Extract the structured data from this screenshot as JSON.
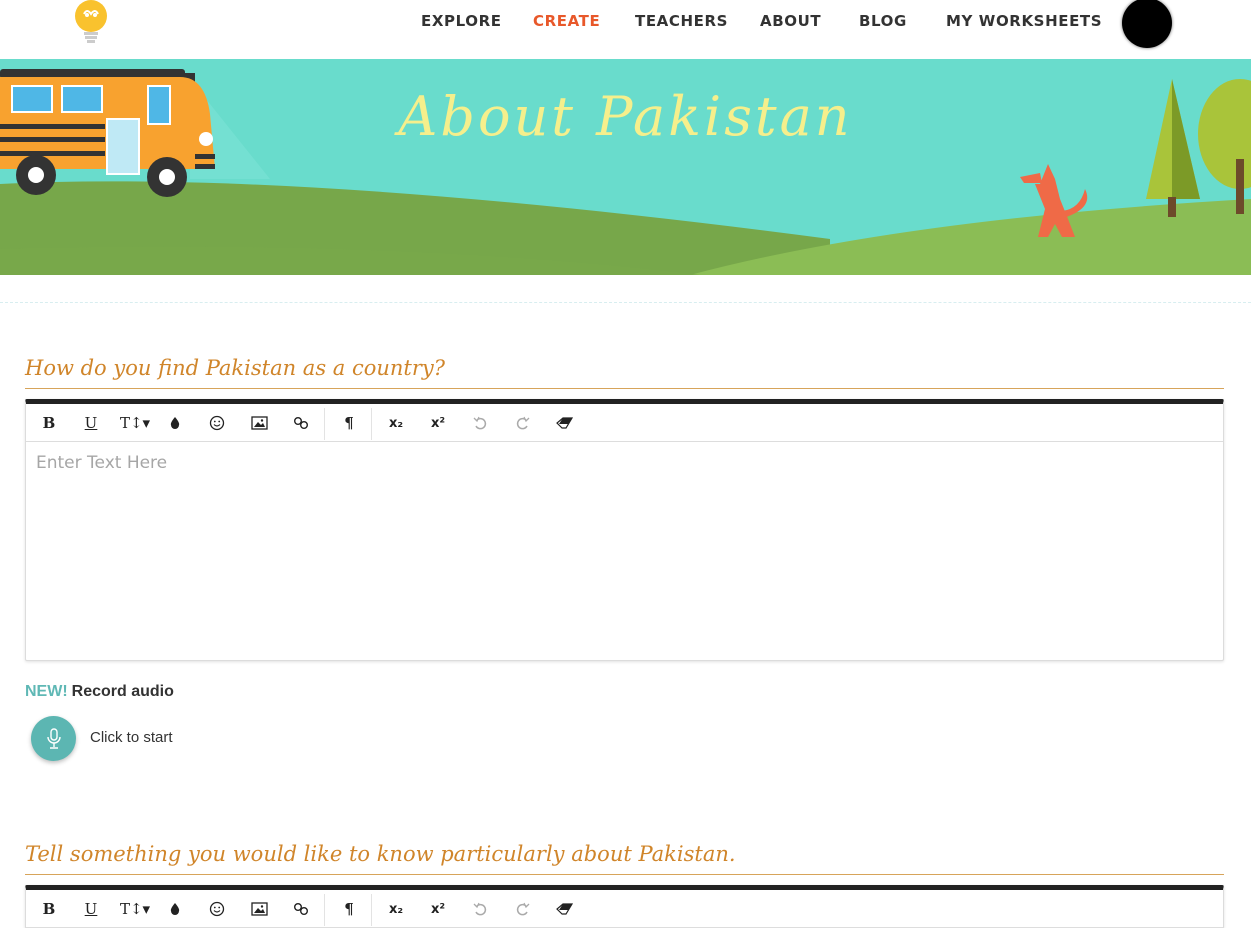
{
  "nav": {
    "links": [
      {
        "label": "EXPLORE"
      },
      {
        "label": "CREATE"
      },
      {
        "label": "TEACHERS"
      },
      {
        "label": "ABOUT"
      },
      {
        "label": "BLOG"
      },
      {
        "label": "MY WORKSHEETS"
      }
    ],
    "active_color": "#e8582a"
  },
  "banner": {
    "title": "About Pakistan",
    "title_color": "#f5ef8c",
    "sky_color": "#69dccc",
    "grass_color": "#7bab4b"
  },
  "questions": [
    {
      "title": "How do you find Pakistan as a country?",
      "editor_placeholder": "Enter Text Here",
      "record_new": "NEW!",
      "record_label": "Record audio",
      "record_action": "Click to start"
    },
    {
      "title": "Tell something you would like to know particularly about Pakistan."
    }
  ],
  "toolbar": {
    "bold": "B",
    "underline": "U",
    "font_size": "T↕▾",
    "color_icon": "color-drop-icon",
    "emoji_icon": "emoji-icon",
    "image_icon": "image-icon",
    "link_icon": "link-icon",
    "paragraph": "¶",
    "subscript": "x₂",
    "superscript": "x²",
    "undo_icon": "undo-icon",
    "redo_icon": "redo-icon",
    "eraser_icon": "eraser-icon"
  },
  "colors": {
    "question_title": "#d0852a",
    "accent_teal": "#5cb6b2"
  }
}
